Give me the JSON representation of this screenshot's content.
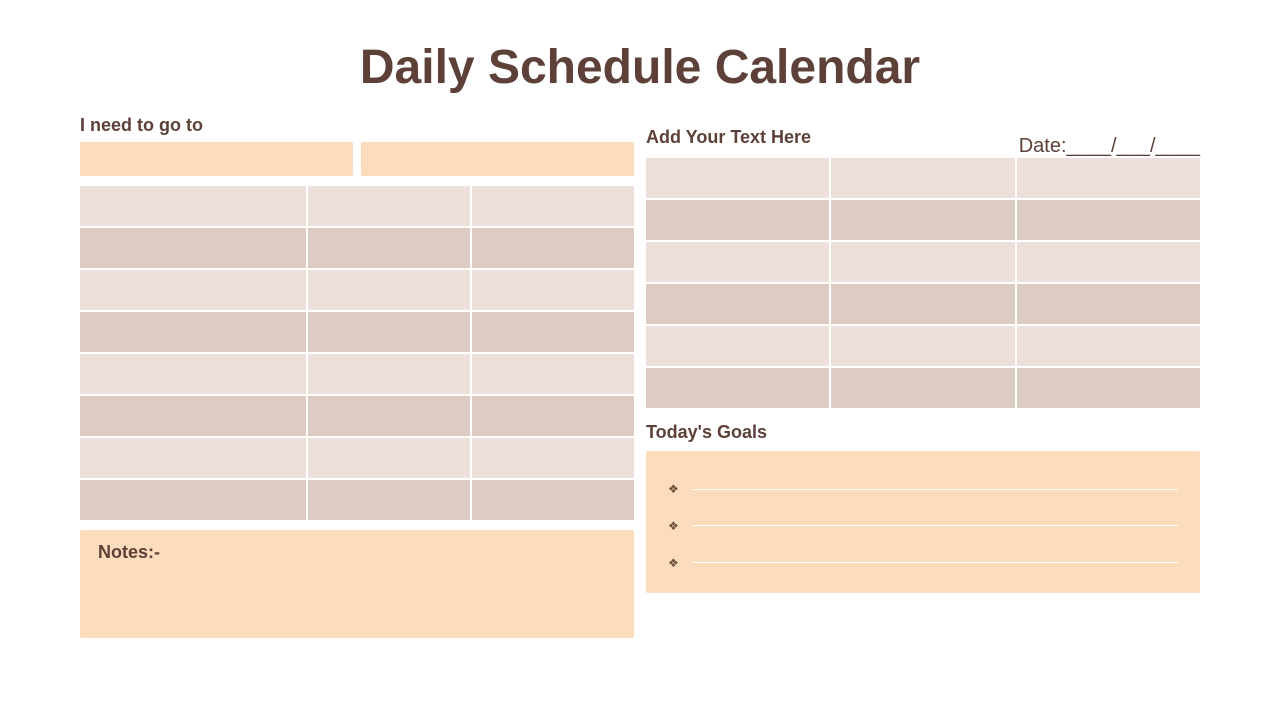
{
  "title": "Daily Schedule Calendar",
  "need_label": "I need to go to",
  "date_label": "Date:____/___/____",
  "add_text_label": "Add Your Text Here",
  "notes_label": "Notes:-",
  "goals_label": "Today's Goals",
  "bullet": "❖"
}
